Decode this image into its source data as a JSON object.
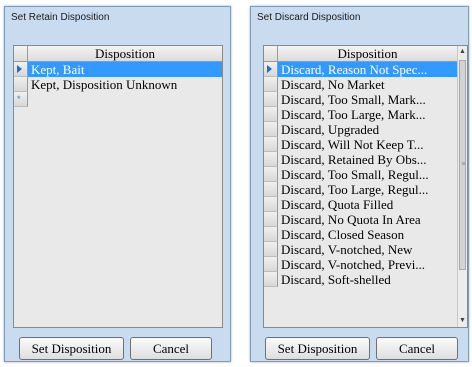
{
  "retain_dialog": {
    "title": "Set Retain Disposition",
    "grid": {
      "header": "Disposition",
      "selected_index": 0,
      "rows": [
        "Kept, Bait",
        "Kept, Disposition Unknown"
      ],
      "new_row_marker": "*"
    },
    "set_button": "Set Disposition",
    "cancel_button": "Cancel"
  },
  "discard_dialog": {
    "title": "Set Discard Disposition",
    "grid": {
      "header": "Disposition",
      "selected_index": 0,
      "rows": [
        "Discard, Reason Not Spec...",
        "Discard, No Market",
        "Discard, Too Small, Mark...",
        "Discard, Too Large, Mark...",
        "Discard, Upgraded",
        "Discard, Will Not Keep T...",
        "Discard, Retained By Obs...",
        "Discard, Too Small, Regul...",
        "Discard, Too Large, Regul...",
        "Discard, Quota Filled",
        "Discard, No Quota In Area",
        "Discard, Closed Season",
        "Discard, V-notched, New",
        "Discard, V-notched, Previ...",
        "Discard, Soft-shelled"
      ],
      "scroll_up_icon": "arrow-up",
      "scroll_down_icon": "arrow-down"
    },
    "set_button": "Set Disposition",
    "cancel_button": "Cancel"
  },
  "colors": {
    "dialog_bg": "#c9dcef",
    "selection": "#3399ff",
    "grid_bg": "#e9e9e9"
  }
}
